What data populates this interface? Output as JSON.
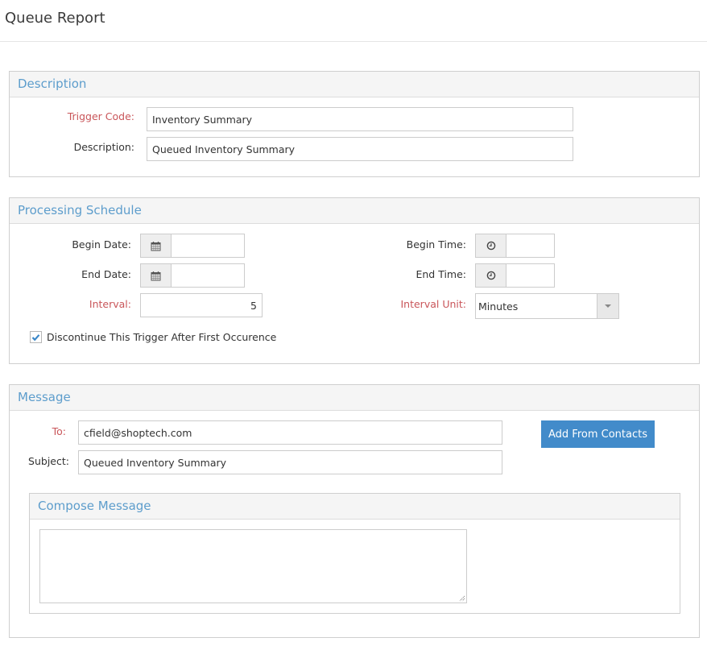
{
  "page": {
    "title": "Queue Report"
  },
  "description_panel": {
    "title": "Description",
    "trigger_code": {
      "label": "Trigger Code:",
      "value": "Inventory Summary",
      "required": true
    },
    "description": {
      "label": "Description:",
      "value": "Queued Inventory Summary",
      "required": false
    }
  },
  "schedule_panel": {
    "title": "Processing Schedule",
    "begin_date": {
      "label": "Begin Date:",
      "value": "",
      "icon": "calendar-icon"
    },
    "end_date": {
      "label": "End Date:",
      "value": "",
      "icon": "calendar-icon"
    },
    "interval": {
      "label": "Interval:",
      "value": "5",
      "required": true
    },
    "begin_time": {
      "label": "Begin Time:",
      "value": "",
      "icon": "clock-icon"
    },
    "end_time": {
      "label": "End Time:",
      "value": "",
      "icon": "clock-icon"
    },
    "interval_unit": {
      "label": "Interval Unit:",
      "value": "Minutes",
      "required": true
    },
    "discontinue": {
      "label": "Discontinue This Trigger After First Occurence",
      "checked": true
    }
  },
  "message_panel": {
    "title": "Message",
    "to": {
      "label": "To:",
      "value": "cfield@shoptech.com",
      "required": true
    },
    "subject": {
      "label": "Subject:",
      "value": "Queued Inventory Summary"
    },
    "add_from_contacts_label": "Add From Contacts",
    "compose": {
      "title": "Compose Message",
      "value": ""
    }
  },
  "colors": {
    "accent": "#428bca",
    "panel_title": "#5d9dcc",
    "required_label": "#c9565a"
  }
}
